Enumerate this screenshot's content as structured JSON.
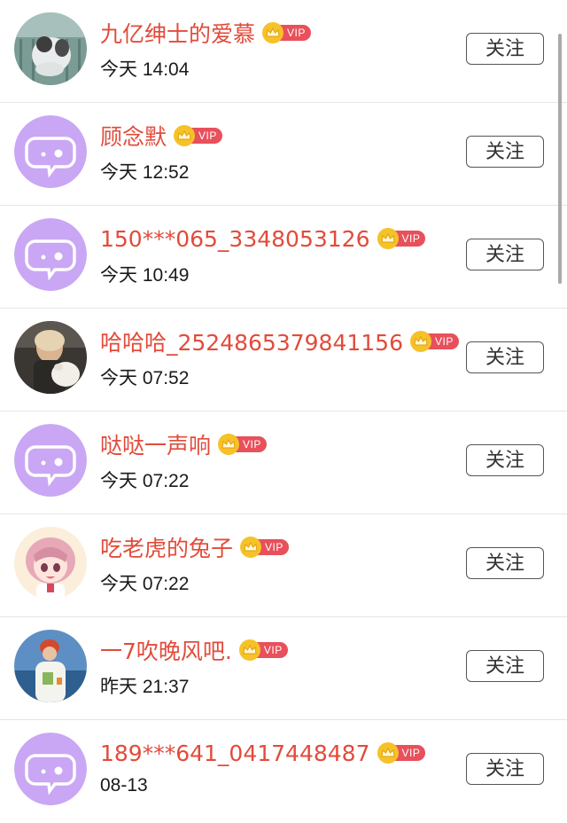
{
  "rows": [
    {
      "name": "九亿绅士的爱慕",
      "time": "今天 14:04",
      "avatar": "photo-cat"
    },
    {
      "name": "顾念默",
      "time": "今天 12:52",
      "avatar": "default"
    },
    {
      "name": "150***065_3348053126",
      "time": "今天 10:49",
      "avatar": "default"
    },
    {
      "name": "哈哈哈_2524865379841156",
      "time": "今天 07:52",
      "avatar": "photo-girl-lamb"
    },
    {
      "name": "哒哒一声响",
      "time": "今天 07:22",
      "avatar": "default"
    },
    {
      "name": "吃老虎的兔子",
      "time": "今天 07:22",
      "avatar": "anime-girl"
    },
    {
      "name": "一7吹晚风吧.",
      "time": "昨天 21:37",
      "avatar": "photo-person-sea"
    },
    {
      "name": "189***641_0417448487",
      "time": "08-13",
      "avatar": "default"
    }
  ],
  "vip_label": "VIP",
  "follow_label": "关注",
  "colors": {
    "name": "#e24b3b",
    "vip_tag": "#e8505b",
    "vip_crown": "#f5c228",
    "default_avatar": "#c9a7f4"
  }
}
